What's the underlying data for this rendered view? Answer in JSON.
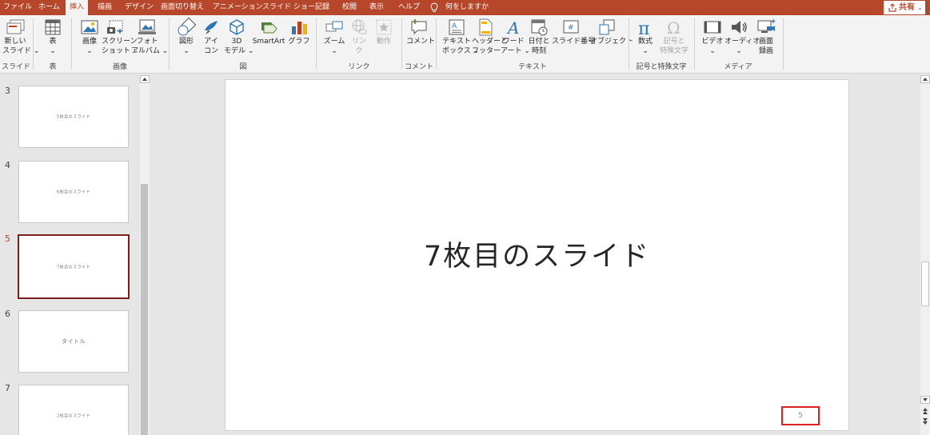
{
  "menubar": {
    "tabs": [
      "ファイル",
      "ホーム",
      "挿入",
      "描画",
      "デザイン",
      "画面切り替え",
      "アニメーション",
      "スライド ショー",
      "記録",
      "校閲",
      "表示",
      "ヘルプ"
    ],
    "active_tab": "挿入",
    "tellme": "何をしますか",
    "share": "共有"
  },
  "ribbon": {
    "buttons": {
      "new_slide": [
        "新しい",
        "スライド ⌄"
      ],
      "table": [
        "表",
        "⌄"
      ],
      "images": [
        "画像",
        "⌄"
      ],
      "screenshot": [
        "スクリーン",
        "ショット ⌄"
      ],
      "photo_album": [
        "フォト",
        "アルバム ⌄"
      ],
      "shapes": [
        "図形",
        "⌄"
      ],
      "icons": [
        "アイ",
        "コン"
      ],
      "models3d": [
        "3D",
        "モデル ⌄"
      ],
      "smartart": [
        "SmartArt"
      ],
      "chart": [
        "グラフ"
      ],
      "zoom": [
        "ズーム",
        "⌄"
      ],
      "link": [
        "リン",
        "ク"
      ],
      "action": [
        "動作"
      ],
      "comment": [
        "コメント"
      ],
      "textbox": [
        "テキスト",
        "ボックス ⌄"
      ],
      "header_footer": [
        "ヘッダーと",
        "フッター"
      ],
      "wordart": [
        "ワード",
        "アート ⌄"
      ],
      "date_time": [
        "日付と",
        "時刻"
      ],
      "slide_number": [
        "スライド番号"
      ],
      "object": [
        "オブジェクト"
      ],
      "equation": [
        "数式",
        "⌄"
      ],
      "symbol": [
        "記号と",
        "特殊文字"
      ],
      "video": [
        "ビデオ",
        "⌄"
      ],
      "audio": [
        "オーディオ",
        "⌄"
      ],
      "screen_recording": [
        "画面",
        "録画"
      ]
    },
    "groups": {
      "slides": "スライド",
      "tables": "表",
      "images": "画像",
      "illustrations": "図",
      "links": "リンク",
      "comments": "コメント",
      "text": "テキスト",
      "symbols": "記号と特殊文字",
      "media": "メディア"
    }
  },
  "slides": [
    {
      "number": "3",
      "title": "5枚目のスライド",
      "footer": "3",
      "selected": false
    },
    {
      "number": "4",
      "title": "6枚目のスライド",
      "footer": "4",
      "selected": false
    },
    {
      "number": "5",
      "title": "7枚目のスライド",
      "footer": "5",
      "selected": true
    },
    {
      "number": "6",
      "title": "タイトル",
      "footer": "",
      "selected": false
    },
    {
      "number": "7",
      "title": "2枚目のスライド",
      "footer": "",
      "selected": false
    }
  ],
  "current_slide": {
    "title": "7枚目のスライド",
    "slide_number": "5"
  },
  "colors": {
    "accent": "#b7472a",
    "selected_thumb_border": "#7b1e1e",
    "highlight_box": "#e02020"
  }
}
